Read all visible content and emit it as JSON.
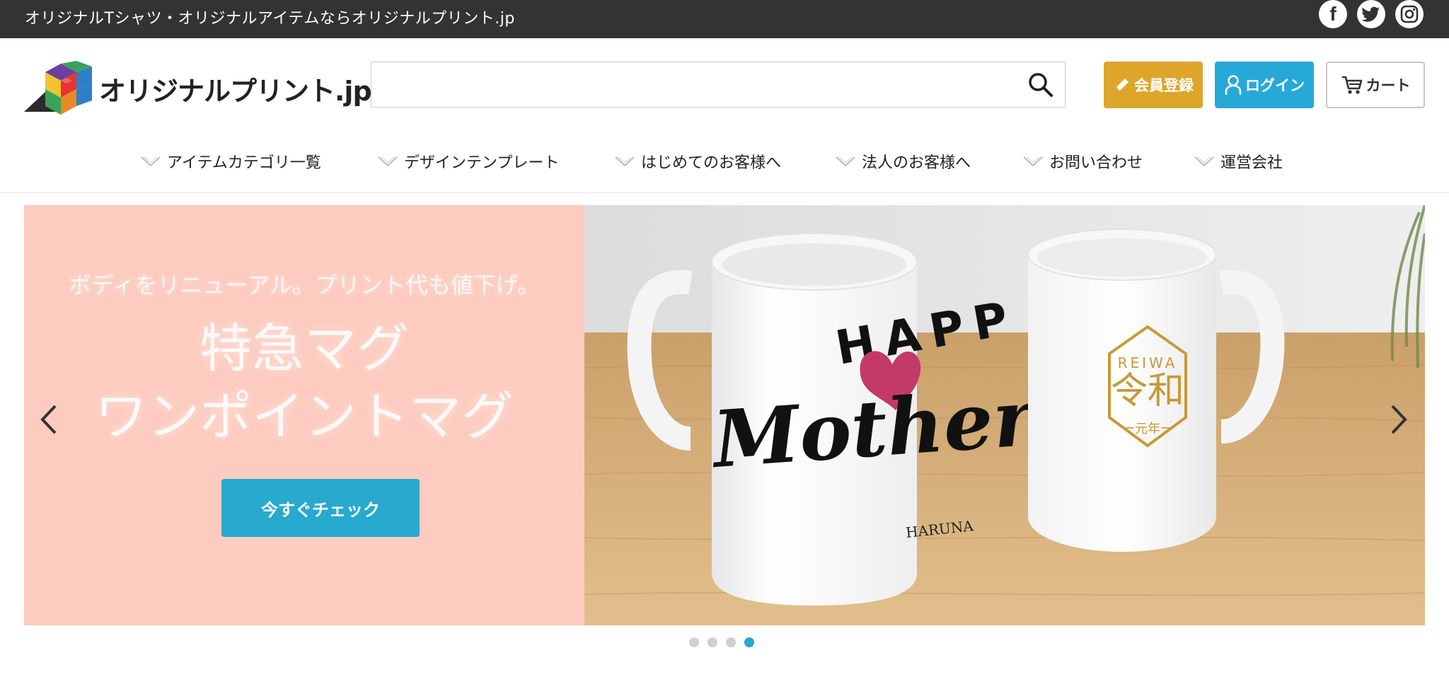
{
  "topbar": {
    "tagline": "オリジナルTシャツ・オリジナルアイテムならオリジナルプリント.jp",
    "social": [
      "facebook-icon",
      "twitter-icon",
      "instagram-icon"
    ]
  },
  "header": {
    "logo_text": "オリジナルプリント.jp",
    "search_placeholder": "",
    "buttons": {
      "register": "会員登録",
      "login": "ログイン",
      "cart": "カート"
    }
  },
  "nav": {
    "items": [
      {
        "label": "アイテムカテゴリ一覧"
      },
      {
        "label": "デザインテンプレート"
      },
      {
        "label": "はじめてのお客様へ"
      },
      {
        "label": "法人のお客様へ"
      },
      {
        "label": "お問い合わせ"
      },
      {
        "label": "運営会社"
      }
    ]
  },
  "hero": {
    "subtitle": "ボディをリニューアル。プリント代も値下げ。",
    "title_line1": "特急マグ",
    "title_line2": "ワンポイントマグ",
    "cta": "今すぐチェック",
    "mug1_text_top": "HAPP",
    "mug1_text_main": "Mother's",
    "mug1_text_sign": "HARUNA",
    "mug2_text_top": "REIWA",
    "mug2_text_main": "令和",
    "mug2_text_bottom": "ー元年ー",
    "slides_total": 4,
    "slide_active": 4
  },
  "colors": {
    "topbar": "#333333",
    "register": "#dda62a",
    "login": "#27a9d8",
    "hero_bg": "#fdcbbf",
    "cta": "#28a9ce",
    "dot_active": "#2aa7c9"
  }
}
